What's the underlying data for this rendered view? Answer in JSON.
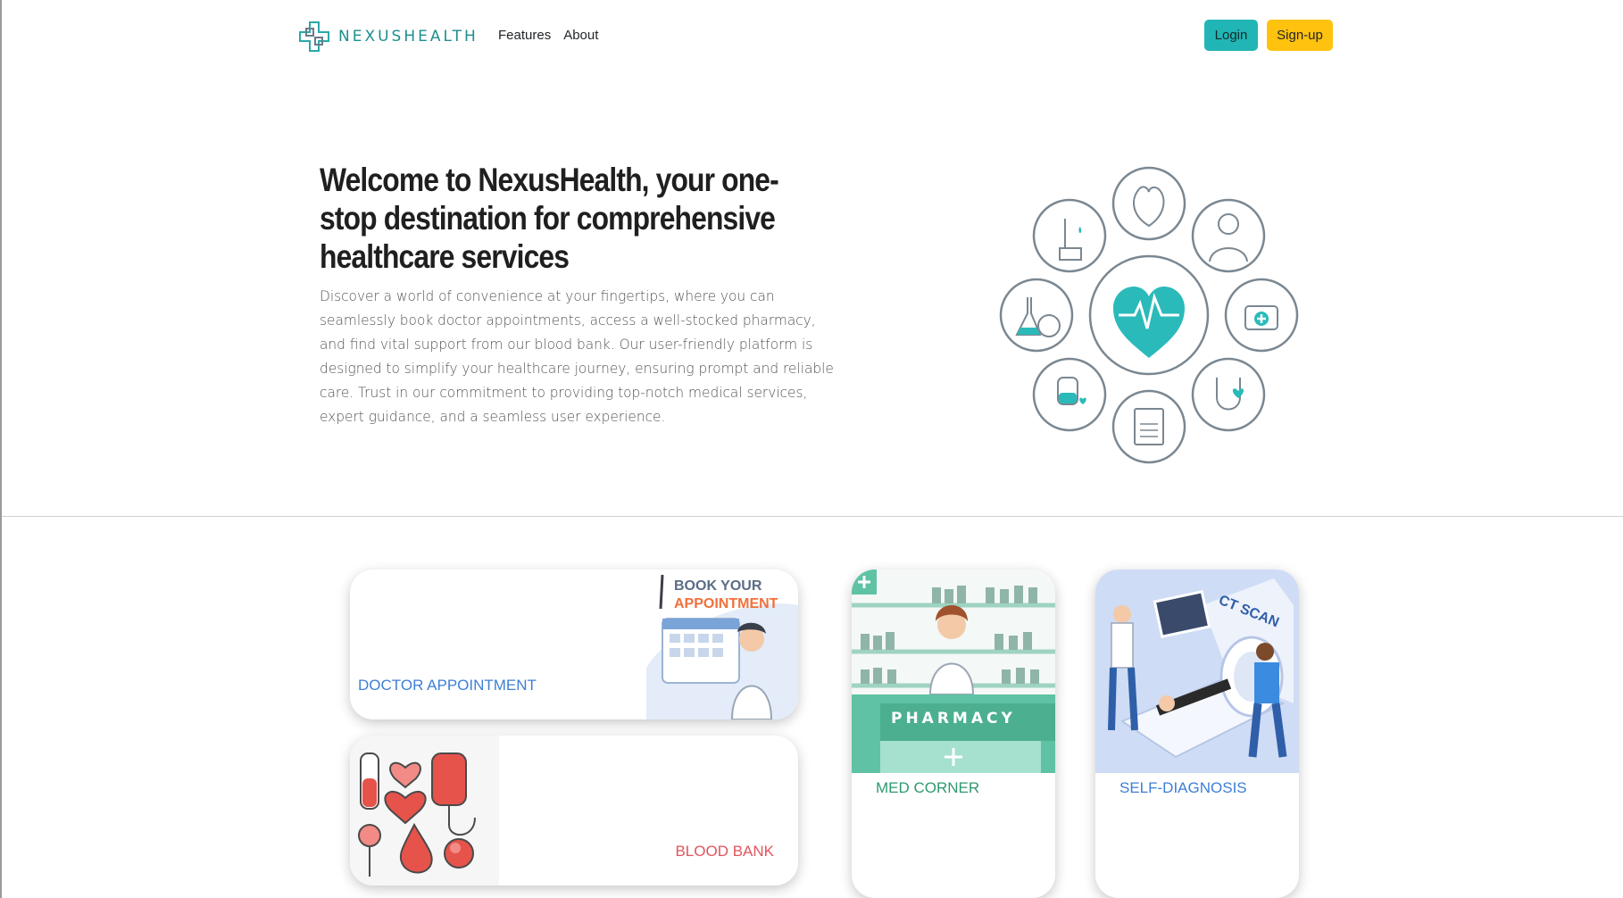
{
  "brand": {
    "name": "NEXUSHEALTH"
  },
  "nav": {
    "links": [
      {
        "label": "Features"
      },
      {
        "label": "About"
      }
    ]
  },
  "auth": {
    "login_label": "Login",
    "signup_label": "Sign-up"
  },
  "hero": {
    "title": "Welcome to NexusHealth, your one-stop destination for comprehensive healthcare services",
    "text": "Discover a world of convenience at your fingertips, where you can seamlessly book doctor appointments, access a well-stocked pharmacy, and find vital support from our blood bank. Our user-friendly platform is designed to simplify your healthcare journey, ensuring prompt and reliable care. Trust in our commitment to providing top-notch medical services, expert guidance, and a seamless user experience."
  },
  "cards": {
    "doctor": {
      "label": "DOCTOR APPOINTMENT",
      "art_line1": "BOOK YOUR",
      "art_line2": "APPOINTMENT"
    },
    "blood": {
      "label": "BLOOD BANK"
    },
    "med": {
      "label": "MED CORNER",
      "art_sign": "PHARMACY"
    },
    "self": {
      "label": "SELF-DIAGNOSIS",
      "art_sign": "CT SCAN"
    }
  },
  "colors": {
    "teal": "#22b5b5",
    "yellow": "#ffc20e",
    "blue": "#3d7fd6",
    "red": "#e2545e",
    "green": "#2e9a6e"
  }
}
